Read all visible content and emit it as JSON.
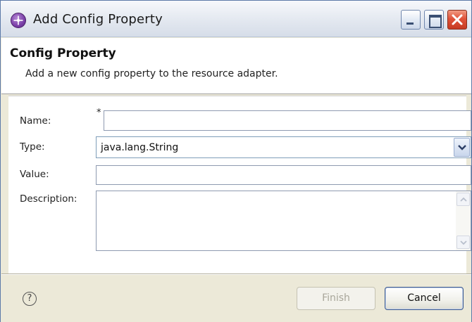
{
  "window": {
    "title": "Add Config Property",
    "controls": [
      "minimize",
      "maximize",
      "close"
    ]
  },
  "header": {
    "title": "Config Property",
    "description": "Add a new config property to the resource adapter."
  },
  "form": {
    "name": {
      "label": "Name:",
      "required_marker": "*",
      "value": ""
    },
    "type": {
      "label": "Type:",
      "value": "java.lang.String"
    },
    "value": {
      "label": "Value:",
      "value": ""
    },
    "description": {
      "label": "Description:",
      "value": ""
    }
  },
  "footer": {
    "help_glyph": "?",
    "finish_label": "Finish",
    "finish_enabled": false,
    "cancel_label": "Cancel"
  },
  "icons": [
    "app-icon",
    "minimize-icon",
    "maximize-icon",
    "close-icon",
    "chevron-down-icon",
    "scroll-up-icon",
    "scroll-down-icon",
    "help-icon"
  ]
}
